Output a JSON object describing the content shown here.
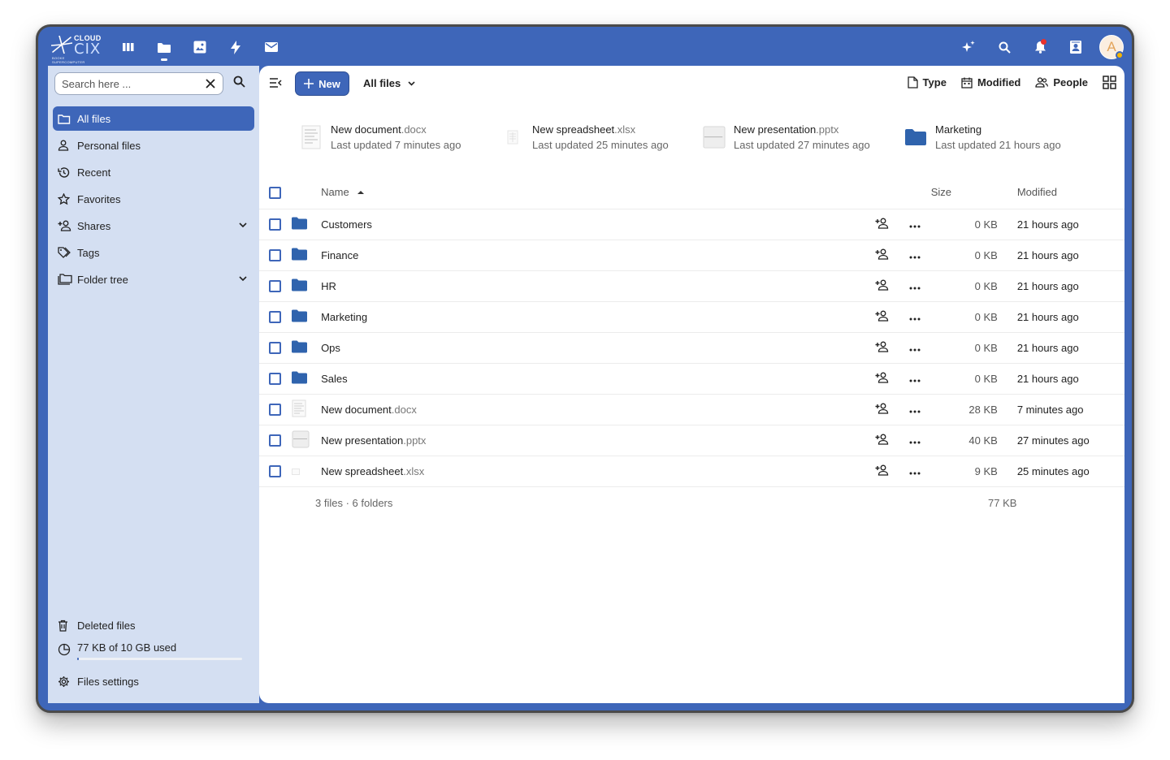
{
  "brand": {
    "line1": "CLOUD",
    "line2": "CIX",
    "line3": "BOOKE SUPERCOMPUTER"
  },
  "colors": {
    "accent": "#3e66b9",
    "sidebar_bg": "#d4dff2",
    "folder": "#2f63ad"
  },
  "header": {
    "apps": [
      "dashboard-icon",
      "files-icon",
      "photos-icon",
      "activity-icon",
      "mail-icon"
    ],
    "active_app": "files-icon",
    "right": [
      "assistant-icon",
      "search-icon",
      "notifications-icon",
      "contacts-icon"
    ],
    "avatar_letter": "A"
  },
  "sidebar": {
    "search_placeholder": "Search here ...",
    "items": [
      {
        "label": "All files",
        "icon": "folder-outline-icon",
        "active": true
      },
      {
        "label": "Personal files",
        "icon": "account-icon"
      },
      {
        "label": "Recent",
        "icon": "history-icon"
      },
      {
        "label": "Favorites",
        "icon": "star-icon"
      },
      {
        "label": "Shares",
        "icon": "share-icon",
        "expandable": true
      },
      {
        "label": "Tags",
        "icon": "tag-icon"
      },
      {
        "label": "Folder tree",
        "icon": "folder-multiple-icon",
        "expandable": true
      }
    ],
    "deleted": "Deleted files",
    "quota": "77 KB of 10 GB used",
    "quota_fraction": 0.01,
    "settings": "Files settings"
  },
  "toolbar": {
    "new_label": "New",
    "breadcrumb": "All files",
    "filters": {
      "type": "Type",
      "modified": "Modified",
      "people": "People"
    }
  },
  "recent": [
    {
      "name": "New document",
      "ext": ".docx",
      "sub": "Last updated 7 minutes ago",
      "kind": "doc"
    },
    {
      "name": "New spreadsheet",
      "ext": ".xlsx",
      "sub": "Last updated 25 minutes ago",
      "kind": "sheet"
    },
    {
      "name": "New presentation",
      "ext": ".pptx",
      "sub": "Last updated 27 minutes ago",
      "kind": "slides"
    },
    {
      "name": "Marketing",
      "ext": "",
      "sub": "Last updated 21 hours ago",
      "kind": "folder"
    }
  ],
  "table": {
    "headers": {
      "name": "Name",
      "size": "Size",
      "modified": "Modified"
    },
    "rows": [
      {
        "name": "Customers",
        "ext": "",
        "kind": "folder",
        "size": "0 KB",
        "modified": "21 hours ago"
      },
      {
        "name": "Finance",
        "ext": "",
        "kind": "folder",
        "size": "0 KB",
        "modified": "21 hours ago"
      },
      {
        "name": "HR",
        "ext": "",
        "kind": "folder",
        "size": "0 KB",
        "modified": "21 hours ago"
      },
      {
        "name": "Marketing",
        "ext": "",
        "kind": "folder",
        "size": "0 KB",
        "modified": "21 hours ago"
      },
      {
        "name": "Ops",
        "ext": "",
        "kind": "folder",
        "size": "0 KB",
        "modified": "21 hours ago"
      },
      {
        "name": "Sales",
        "ext": "",
        "kind": "folder",
        "size": "0 KB",
        "modified": "21 hours ago"
      },
      {
        "name": "New document",
        "ext": ".docx",
        "kind": "doc",
        "size": "28 KB",
        "modified": "7 minutes ago"
      },
      {
        "name": "New presentation",
        "ext": ".pptx",
        "kind": "slides",
        "size": "40 KB",
        "modified": "27 minutes ago"
      },
      {
        "name": "New spreadsheet",
        "ext": ".xlsx",
        "kind": "sheet",
        "size": "9 KB",
        "modified": "25 minutes ago"
      }
    ],
    "summary": "3 files · 6 folders",
    "total_size": "77 KB"
  }
}
